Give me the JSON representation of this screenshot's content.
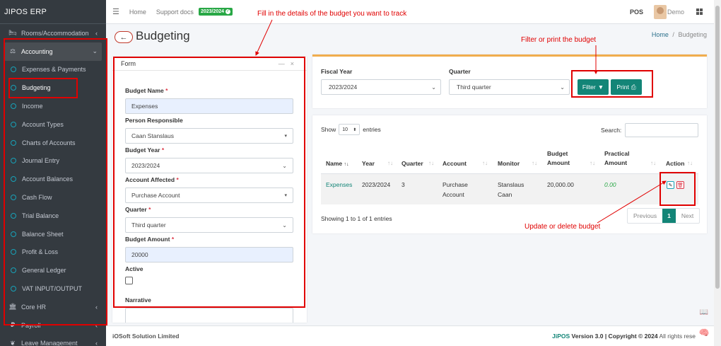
{
  "app": {
    "brand": "JIPOS ERP"
  },
  "topbar": {
    "home": "Home",
    "support": "Support docs",
    "version_badge": "2023/2024",
    "pos": "POS",
    "user": "Demo"
  },
  "sidebar": {
    "items": [
      {
        "label": "Rooms/Accommodation",
        "icon": "bed-icon"
      },
      {
        "label": "Accounting",
        "icon": "scale-icon"
      },
      {
        "label": "Expenses & Payments"
      },
      {
        "label": "Budgeting"
      },
      {
        "label": "Income"
      },
      {
        "label": "Account Types"
      },
      {
        "label": "Charts of Accounts"
      },
      {
        "label": "Journal Entry"
      },
      {
        "label": "Account Balances"
      },
      {
        "label": "Cash Flow"
      },
      {
        "label": "Trial Balance"
      },
      {
        "label": "Balance Sheet"
      },
      {
        "label": "Profit & Loss"
      },
      {
        "label": "General Ledger"
      },
      {
        "label": "VAT INPUT/OUTPUT"
      },
      {
        "label": "Core HR",
        "icon": "bank-icon"
      },
      {
        "label": "Payroll",
        "icon": "payroll-icon"
      },
      {
        "label": "Leave Management",
        "icon": "leaf-icon"
      }
    ]
  },
  "page": {
    "title": "Budgeting",
    "breadcrumb_home": "Home",
    "breadcrumb_sep": "/",
    "breadcrumb_current": "Budgeting"
  },
  "form": {
    "header": "Form",
    "budget_name_label": "Budget Name",
    "budget_name_value": "Expenses",
    "person_label": "Person Responsible",
    "person_value": "Caan Stanslaus",
    "year_label": "Budget Year",
    "year_value": "2023/2024",
    "account_label": "Account Affected",
    "account_value": "Purchase Account",
    "quarter_label": "Quarter",
    "quarter_value": "Third quarter",
    "amount_label": "Budget Amount",
    "amount_value": "20000",
    "active_label": "Active",
    "narrative_label": "Narrative"
  },
  "filter": {
    "fiscal_year_label": "Fiscal Year",
    "fiscal_year_value": "2023/2024",
    "quarter_label": "Quarter",
    "quarter_value": "Third quarter",
    "filter_btn": "Filter",
    "print_btn": "Print"
  },
  "table": {
    "show_label": "Show",
    "length_value": "10",
    "entries_label": "entries",
    "search_label": "Search:",
    "columns": [
      "Name",
      "Year",
      "Quarter",
      "Account",
      "Monitor",
      "Budget Amount",
      "Practical Amount",
      "Action"
    ],
    "columns_split": {
      "budget1": "Budget",
      "budget2": "Amount",
      "practical1": "Practical",
      "practical2": "Amount"
    },
    "rows": [
      {
        "name": "Expenses",
        "year": "2023/2024",
        "quarter": "3",
        "account1": "Purchase",
        "account2": "Account",
        "monitor1": "Stanslaus",
        "monitor2": "Caan",
        "budget": "20,000.00",
        "practical": "0.00"
      }
    ],
    "info": "Showing 1 to 1 of 1 entries",
    "prev": "Previous",
    "page": "1",
    "next": "Next"
  },
  "footer": {
    "company": "iOSoft Solution Limited",
    "brand": "JiPOS",
    "version": "Version 3.0",
    "copyright": "| Copyright © 2024",
    "rights": "All rights rese"
  },
  "annotations": {
    "form_note": "Fill in the details of the budget you want to track",
    "filter_note": "Filter or print the budget",
    "action_note": "Update or delete budget"
  },
  "colors": {
    "teal": "#138577",
    "sidebar": "#343a40",
    "annotation": "#e00000",
    "accent_top": "#f0ad4e"
  }
}
